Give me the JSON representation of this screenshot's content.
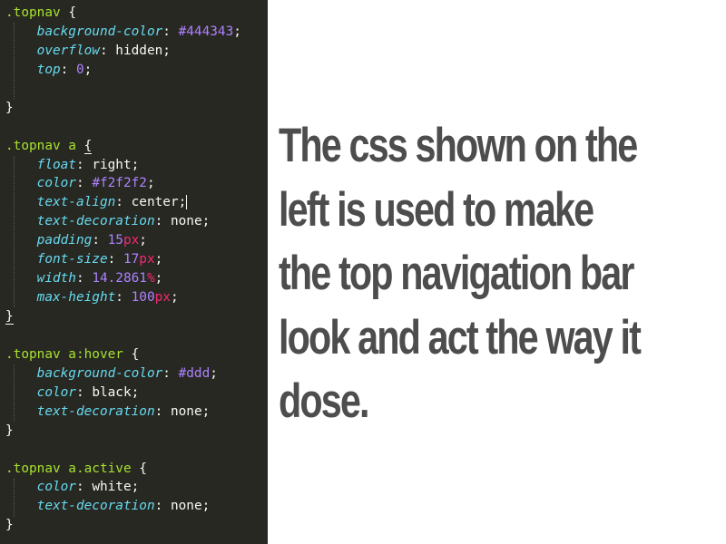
{
  "editor": {
    "rules": [
      {
        "selector": ".topnav",
        "declarations": [
          {
            "prop": "background-color",
            "parts": [
              {
                "t": "#444343",
                "k": "num"
              }
            ]
          },
          {
            "prop": "overflow",
            "parts": [
              {
                "t": "hidden",
                "k": "val"
              }
            ]
          },
          {
            "prop": "top",
            "parts": [
              {
                "t": "0",
                "k": "num"
              }
            ]
          }
        ],
        "blank_before_close": true
      },
      {
        "selector": ".topnav a",
        "declarations": [
          {
            "prop": "float",
            "parts": [
              {
                "t": "right",
                "k": "val"
              }
            ]
          },
          {
            "prop": "color",
            "parts": [
              {
                "t": "#f2f2f2",
                "k": "num"
              }
            ]
          },
          {
            "prop": "text-align",
            "parts": [
              {
                "t": "center",
                "k": "val"
              }
            ],
            "caret": true
          },
          {
            "prop": "text-decoration",
            "parts": [
              {
                "t": "none",
                "k": "val"
              }
            ]
          },
          {
            "prop": "padding",
            "parts": [
              {
                "t": "15",
                "k": "num"
              },
              {
                "t": "px",
                "k": "unit"
              }
            ]
          },
          {
            "prop": "font-size",
            "parts": [
              {
                "t": "17",
                "k": "num"
              },
              {
                "t": "px",
                "k": "unit"
              }
            ]
          },
          {
            "prop": "width",
            "parts": [
              {
                "t": "14.2861",
                "k": "num"
              },
              {
                "t": "%",
                "k": "unit"
              }
            ]
          },
          {
            "prop": "max-height",
            "parts": [
              {
                "t": "100",
                "k": "num"
              },
              {
                "t": "px",
                "k": "unit"
              }
            ]
          }
        ],
        "highlight_braces": true
      },
      {
        "selector": ".topnav a:hover",
        "declarations": [
          {
            "prop": "background-color",
            "parts": [
              {
                "t": "#ddd",
                "k": "num"
              }
            ]
          },
          {
            "prop": "color",
            "parts": [
              {
                "t": "black",
                "k": "val"
              }
            ]
          },
          {
            "prop": "text-decoration",
            "parts": [
              {
                "t": "none",
                "k": "val"
              }
            ]
          }
        ]
      },
      {
        "selector": ".topnav a.active",
        "declarations": [
          {
            "prop": "color",
            "parts": [
              {
                "t": "white",
                "k": "val"
              }
            ]
          },
          {
            "prop": "text-decoration",
            "parts": [
              {
                "t": "none",
                "k": "val"
              }
            ]
          }
        ]
      }
    ]
  },
  "caption": {
    "lines": [
      "The css shown on the",
      "left is used to make",
      "the top navigation bar",
      "look and act the way it",
      "dose."
    ]
  }
}
